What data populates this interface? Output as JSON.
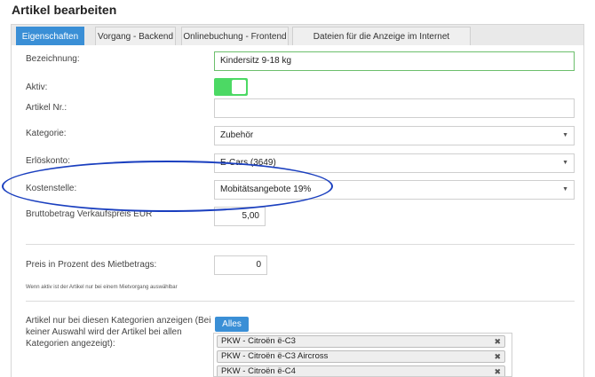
{
  "page": {
    "title": "Artikel bearbeiten"
  },
  "tabs": [
    {
      "label": "Eigenschaften",
      "active": true
    },
    {
      "label": "Vorgang - Backend",
      "active": false
    },
    {
      "label": "Onlinebuchung - Frontend",
      "active": false
    },
    {
      "label": "Dateien für die Anzeige im Internet hochladen",
      "active": false
    }
  ],
  "form": {
    "bezeichnung": {
      "label": "Bezeichnung:",
      "value": "Kindersitz 9-18 kg"
    },
    "aktiv": {
      "label": "Aktiv:",
      "on": true
    },
    "artikel_nr": {
      "label": "Artikel Nr.:",
      "value": ""
    },
    "kategorie": {
      "label": "Kategorie:",
      "value": "Zubehör"
    },
    "erloeskonto": {
      "label": "Erlöskonto:",
      "value": "E-Cars (3649)"
    },
    "kostenstelle": {
      "label": "Kostenstelle:",
      "value": "Mobitätsangebote 19%"
    },
    "brutto": {
      "label": "Bruttobetrag Verkaufspreis EUR",
      "value": "5,00"
    },
    "preis_prozent": {
      "label": "Preis in Prozent des Mietbetrags:",
      "value": "0",
      "note": "Wenn aktiv ist der Artikel nur bei einem Mietvorgang auswählbar"
    },
    "kategorien": {
      "label_lines": [
        "Artikel nur bei diesen Kategorien anzeigen (Bei",
        "keiner Auswahl wird der Artikel bei allen",
        "Kategorien angezeigt):"
      ],
      "button": "Alles",
      "selected": [
        "PKW - Citroën ë-C3",
        "PKW - Citroën ë-C3 Aircross",
        "PKW - Citroën ë-C4"
      ]
    }
  },
  "icons": {
    "caret": "caret-down-icon",
    "remove": "remove-x-icon"
  },
  "colors": {
    "accent": "#3a8fd6",
    "toggle_on": "#4cd964",
    "highlight": "#1a3fbf"
  }
}
